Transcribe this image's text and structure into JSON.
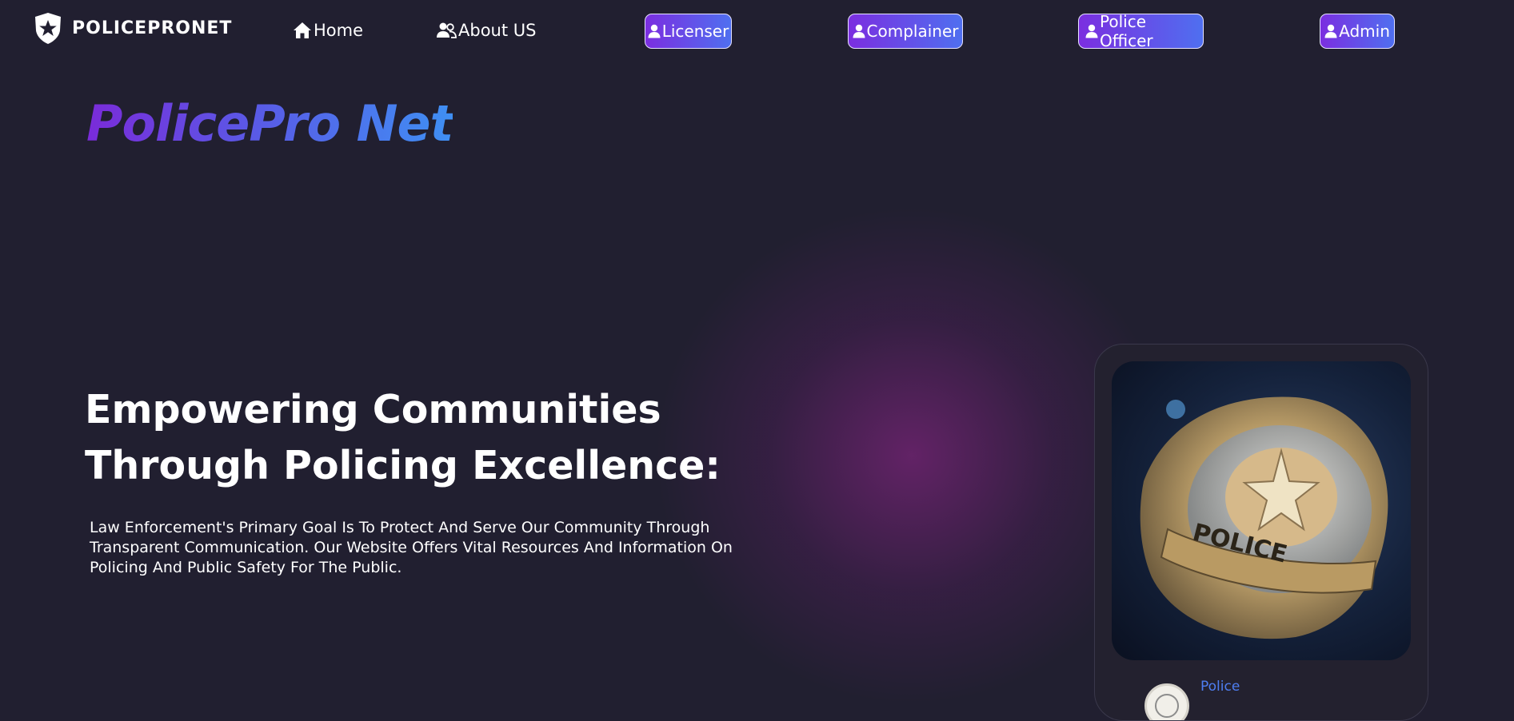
{
  "header": {
    "logo_text": "POLICEPRONET",
    "logo_icon": "police-shield-star-icon",
    "nav": [
      {
        "label": "Home",
        "icon": "home-icon"
      },
      {
        "label": "About US",
        "icon": "users-icon"
      }
    ],
    "roles": [
      {
        "label": "Licenser",
        "icon": "user-icon"
      },
      {
        "label": "Complainer",
        "icon": "user-icon"
      },
      {
        "label": "Police Officer",
        "icon": "user-icon"
      },
      {
        "label": "Admin",
        "icon": "user-icon"
      }
    ]
  },
  "hero": {
    "brand_title": "PolicePro Net",
    "headline_line1": "Empowering Communities",
    "headline_line2": "Through Policing Excellence:",
    "description": "Law Enforcement's Primary Goal Is To Protect And Serve Our Community Through Transparent Communication. Our Website Offers Vital Resources And Information On Policing And Public Safety For The Public."
  },
  "card": {
    "badge_text": "POLICE",
    "name": "Police"
  },
  "colors": {
    "background": "#211f30",
    "accent_purple": "#7b2ee0",
    "accent_blue": "#4f6ff0",
    "link_blue": "#4e7ef2"
  }
}
